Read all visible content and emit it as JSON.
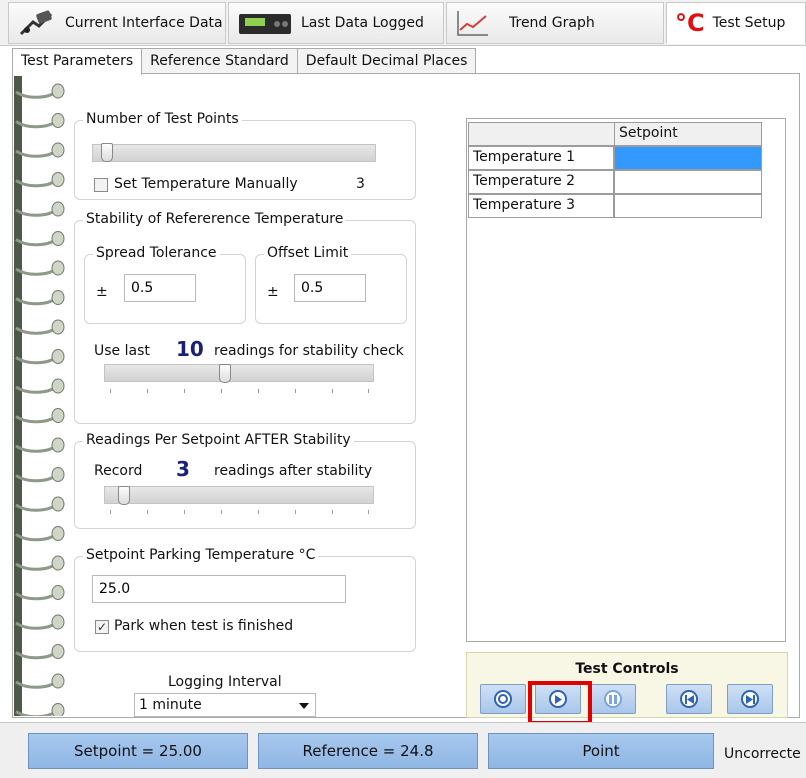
{
  "top_tabs": [
    {
      "label": "Current Interface Data",
      "icon": "connector-icon"
    },
    {
      "label": "Last Data Logged",
      "icon": "logger-device-icon"
    },
    {
      "label": "Trend Graph",
      "icon": "trend-graph-icon"
    },
    {
      "label": "Test Setup",
      "icon": "celsius-icon",
      "icon_text": "°C"
    }
  ],
  "sub_tabs": [
    "Test Parameters",
    "Reference Standard",
    "Default Decimal Places"
  ],
  "test_points": {
    "legend": "Number of Test Points",
    "checkbox_label": "Set Temperature Manually",
    "checkbox_checked": false,
    "count": "3"
  },
  "stability": {
    "legend": "Stability of Refererence Temperature",
    "spread": {
      "legend": "Spread Tolerance",
      "pm": "±",
      "value": "0.5"
    },
    "offset": {
      "legend": "Offset Limit",
      "pm": "±",
      "value": "0.5"
    },
    "use_last_prefix": "Use last",
    "use_last_value": "10",
    "use_last_suffix": "readings for stability check"
  },
  "readings_after": {
    "legend": "Readings Per Setpoint AFTER Stability",
    "record_prefix": "Record",
    "record_value": "3",
    "record_suffix": "readings after stability"
  },
  "parking": {
    "legend": "Setpoint Parking Temperature °C",
    "value": "25.0",
    "park_label": "Park when test is finished",
    "park_checked": true
  },
  "logging": {
    "label": "Logging Interval",
    "selected": "1 minute"
  },
  "setpoint_table": {
    "header": "Setpoint",
    "rows": [
      "Temperature 1",
      "Temperature 2",
      "Temperature 3"
    ]
  },
  "test_controls": {
    "title": "Test Controls"
  },
  "status": {
    "setpoint": "Setpoint = 25.00",
    "reference": "Reference = 24.8",
    "point": "Point",
    "uncorrected": "Uncorrecte"
  },
  "colors": {
    "accent_red": "#e00000",
    "button_blue": "#a9c6ea",
    "value_navy": "#18207a"
  }
}
